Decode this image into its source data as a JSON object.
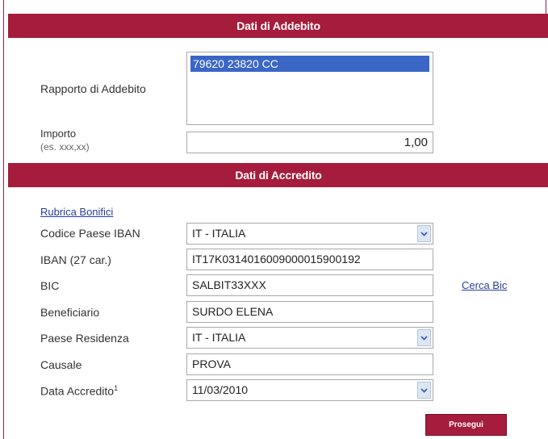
{
  "addebito": {
    "section_title": "Dati di Addebito",
    "rapporto_label": "Rapporto di Addebito",
    "rapporto_selected": "79620 23820 CC",
    "importo_label": "Importo",
    "importo_hint": "(es. xxx,xx)",
    "importo_value": "1,00"
  },
  "accredito": {
    "section_title": "Dati di Accredito",
    "rubrica_link": "Rubrica Bonifici",
    "codice_paese_label": "Codice Paese IBAN",
    "codice_paese_value": "IT - ITALIA",
    "iban_label": "IBAN (27 car.)",
    "iban_value": "IT17K0314016009000015900192",
    "bic_label": "BIC",
    "bic_value": "SALBIT33XXX",
    "cerca_bic_link": "Cerca Bic",
    "beneficiario_label": "Beneficiario",
    "beneficiario_value": "SURDO ELENA",
    "paese_residenza_label": "Paese Residenza",
    "paese_residenza_value": "IT - ITALIA",
    "causale_label": "Causale",
    "causale_value": "PROVA",
    "data_label": "Data Accredito",
    "data_sup": "1",
    "data_value": "11/03/2010"
  },
  "prosegui_label": "Prosegui",
  "colors": {
    "brand": "#a61c3c",
    "selection": "#3a66c6",
    "link": "#2a3f9c"
  }
}
